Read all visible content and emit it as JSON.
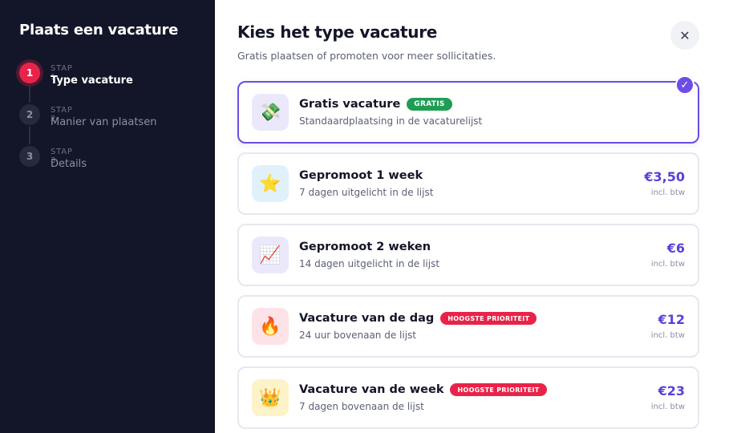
{
  "sidebar": {
    "title": "Plaats een vacature",
    "steps": [
      {
        "number": "1",
        "label": "STAP 1",
        "name": "Type vacature",
        "active": true
      },
      {
        "number": "2",
        "label": "STAP 2",
        "name": "Manier van plaatsen",
        "active": false
      },
      {
        "number": "3",
        "label": "STAP 3",
        "name": "Details",
        "active": false
      }
    ]
  },
  "main": {
    "title": "Kies het type vacature",
    "subtitle": "Gratis plaatsen of promoten voor meer sollicitaties.",
    "close_icon": "close-icon",
    "options": [
      {
        "title": "Gratis vacature",
        "badge": "GRATIS",
        "description": "Standaardplaatsing in de vacaturelijst",
        "price": "",
        "price_note": "",
        "icon": "money-icon",
        "selected": true
      },
      {
        "title": "Gepromoot 1 week",
        "badge": "",
        "description": "7 dagen uitgelicht in de lijst",
        "price": "€3,50",
        "price_note": "incl. btw",
        "icon": "star-icon",
        "selected": false
      },
      {
        "title": "Gepromoot 2 weken",
        "badge": "",
        "description": "14 dagen uitgelicht in de lijst",
        "price": "€6",
        "price_note": "incl. btw",
        "icon": "chart-icon",
        "selected": false
      },
      {
        "title": "Vacature van de dag",
        "badge": "HOOGSTE PRIORITEIT",
        "description": "24 uur bovenaan de lijst",
        "price": "€12",
        "price_note": "incl. btw",
        "icon": "fire-icon",
        "selected": false
      },
      {
        "title": "Vacature van de week",
        "badge": "HOOGSTE PRIORITEIT",
        "description": "7 dagen bovenaan de lijst",
        "price": "€23",
        "price_note": "incl. btw",
        "icon": "crown-icon",
        "selected": false
      }
    ]
  },
  "colors": {
    "sidebar_bg": "#131628",
    "accent": "#6d4de6",
    "active_step": "#e8234a",
    "free_badge": "#1f9d55",
    "priority_badge": "#e8234a"
  }
}
